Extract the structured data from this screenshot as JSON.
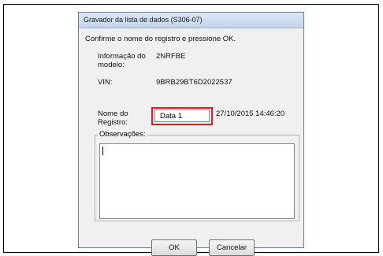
{
  "dialog": {
    "title": "Gravador da lista de dados (S306-07)",
    "instruction": "Confirme o nome do registro e pressione OK.",
    "model_label": "Informação do modelo:",
    "model_value": "2NRFBE",
    "vin_label": "VIN:",
    "vin_value": "9BRB29BT6D2022537",
    "record_name_label": "Nome do Registro:",
    "record_name_value": "Data 1",
    "timestamp": "27/10/2015 14:46:20",
    "notes_label": "Observações:",
    "notes_value": "",
    "ok_label": "OK",
    "cancel_label": "Cancelar"
  }
}
